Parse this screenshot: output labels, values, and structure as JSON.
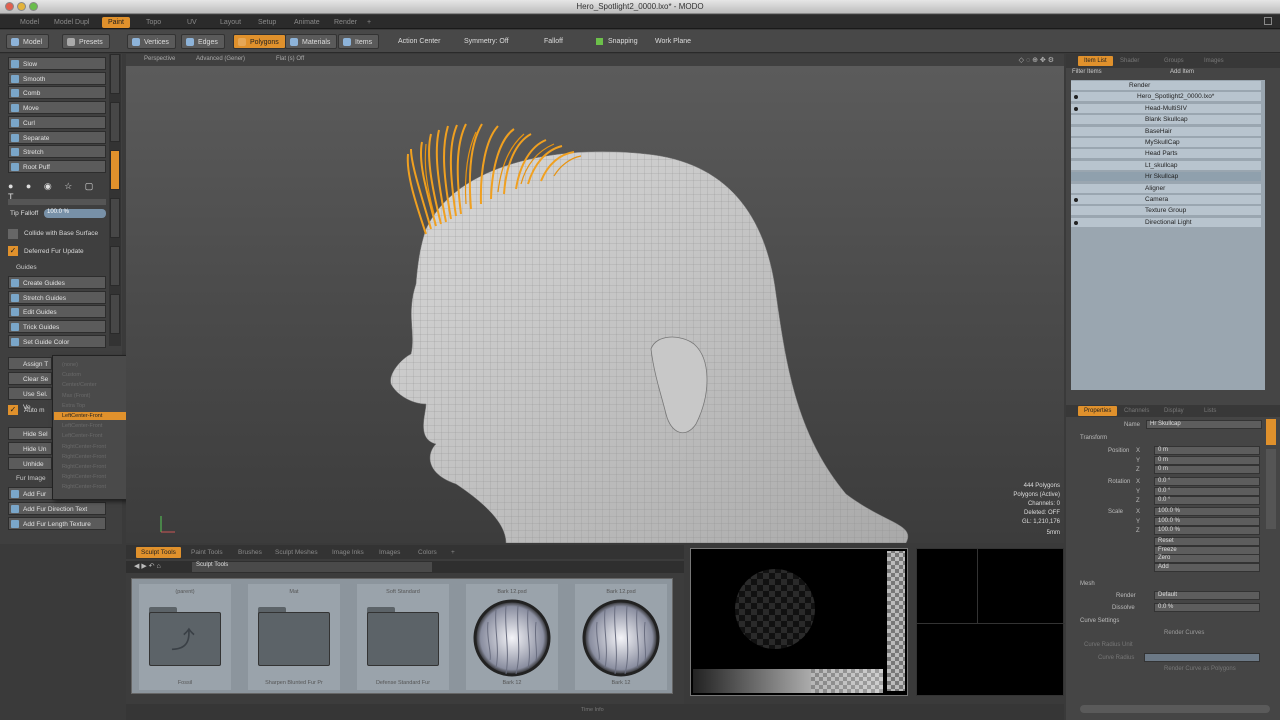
{
  "window": {
    "title": "Hero_Spotlight2_0000.lxo* - MODO"
  },
  "layout_tabs": [
    "Model",
    "Model Dupl",
    "Paint",
    "Topo",
    "UV",
    "Layout",
    "Setup",
    "Animate",
    "Render",
    "+"
  ],
  "toolbar": {
    "model": "Model",
    "presets": "Presets",
    "vertices": "Vertices",
    "edges": "Edges",
    "polygons": "Polygons",
    "materials": "Materials",
    "items": "Items",
    "action_center": "Action Center",
    "symmetry": "Symmetry: Off",
    "falloff": "Falloff",
    "snapping": "Snapping",
    "work_plane": "Work Plane"
  },
  "tools": {
    "fur_tools": [
      "Slow",
      "Smooth",
      "Comb",
      "Move",
      "Curl",
      "Separate",
      "Stretch",
      "Root Puff"
    ],
    "tip_falloff_label": "Tip Falloff",
    "tip_falloff_value": "100.0 %",
    "collide": "Collide with Base Surface",
    "deferred": "Deferred Fur Update",
    "guides_header": "Guides",
    "guides": [
      "Create Guides",
      "Stretch Guides",
      "Edit Guides",
      "Trick Guides",
      "Set Guide Color"
    ],
    "assign": "Assign T",
    "clear": "Clear Se",
    "use_sel": "Use Sel. Ve",
    "auto": "Auto m",
    "hide": [
      "Hide Sel",
      "Hide Un",
      "Unhide"
    ],
    "fur_image": "Fur Image",
    "fur_buttons": [
      "Add Fur",
      "Add Fur Direction Text",
      "Add Fur Length Texture"
    ]
  },
  "dropdown": {
    "items": [
      "(none)",
      "Custom",
      "Center/Center",
      "Max (Front)",
      "Extra Top",
      "LeftCenter-Front",
      "LeftCenter-Front",
      "LeftCenter-Front",
      "RightCenter-Front",
      "RightCenter-Front",
      "RightCenter-Front",
      "RightCenter-Front",
      "RightCenter-Front"
    ],
    "highlighted_index": 5
  },
  "viewport": {
    "tabs": [
      "Perspective",
      "Advanced (Gener)",
      "Flat (s) Off"
    ],
    "info": [
      "444 Polygons",
      "Polygons (Active)",
      "Channels: 0",
      "Deleted: OFF",
      "GL: 1,210,176",
      "5mm"
    ]
  },
  "item_list": {
    "tabs": [
      "Item List",
      "Shader",
      "Groups",
      "Images"
    ],
    "filter": "Filter Items",
    "add_item": "Add Item",
    "rows": [
      {
        "name": "Render",
        "indent": 0,
        "eye": false
      },
      {
        "name": "Hero_Spotlight2_0000.lxo*",
        "indent": 1,
        "eye": true
      },
      {
        "name": "Head-MultiSIV",
        "indent": 2,
        "eye": true
      },
      {
        "name": "Blank Skullcap",
        "indent": 2,
        "eye": false
      },
      {
        "name": "BaseHair",
        "indent": 2,
        "eye": false
      },
      {
        "name": "MySkullCap",
        "indent": 2,
        "eye": false
      },
      {
        "name": "Head Parts",
        "indent": 2,
        "eye": false
      },
      {
        "name": "Lt_skullcap",
        "indent": 2,
        "eye": false
      },
      {
        "name": "Hr Skullcap",
        "indent": 2,
        "eye": false,
        "selected": true
      },
      {
        "name": "Aligner",
        "indent": 2,
        "eye": false
      },
      {
        "name": "Camera",
        "indent": 2,
        "eye": true
      },
      {
        "name": "Texture Group",
        "indent": 2,
        "eye": false
      },
      {
        "name": "Directional Light",
        "indent": 2,
        "eye": true
      }
    ]
  },
  "properties": {
    "tabs": [
      "Properties",
      "Channels",
      "Display",
      "Lists"
    ],
    "name_label": "Name",
    "name_value": "Hr Skullcap",
    "transform": "Transform",
    "position_label": "Position",
    "rotation_label": "Rotation",
    "scale_label": "Scale",
    "axes": [
      "X",
      "Y",
      "Z"
    ],
    "position": [
      "0 m",
      "0 m",
      "0 m"
    ],
    "rotation": [
      "0.0 °",
      "0.0 °",
      "0.0 °"
    ],
    "scale": [
      "100.0 %",
      "100.0 %",
      "100.0 %"
    ],
    "actions": [
      "Reset",
      "Freeze",
      "Zero",
      "Add"
    ],
    "mesh": "Mesh",
    "render_label": "Render",
    "render_value": "Default",
    "dissolve_label": "Dissolve",
    "dissolve_value": "0.0 %",
    "curve_settings": "Curve Settings",
    "render_curves": "Render Curves",
    "curve_radius_unit": "Curve Radius Unit",
    "curve_radius": "Curve Radius",
    "render_curve_polys": "Render Curve as Polygons"
  },
  "bottom": {
    "tabs": [
      "Sculpt Tools",
      "Paint Tools",
      "Brushes",
      "Sculpt Meshes",
      "Image Inks",
      "Images",
      "Colors",
      "+"
    ],
    "path": "Sculpt Tools",
    "items": [
      {
        "title": "(parent)",
        "label": "Fossil",
        "type": "folder-up"
      },
      {
        "title": "Mat",
        "label": "Sharpen Blunted Fur Pr",
        "type": "folder"
      },
      {
        "title": "Soft Standard",
        "label": "Defense Standard Fur",
        "type": "folder"
      },
      {
        "title": "Bark 12.psd",
        "label": "Bark 12",
        "type": "fur"
      },
      {
        "title": "Bark 12.psd",
        "label": "Bark 12",
        "type": "fur"
      }
    ]
  },
  "statusbar": "Time Info"
}
